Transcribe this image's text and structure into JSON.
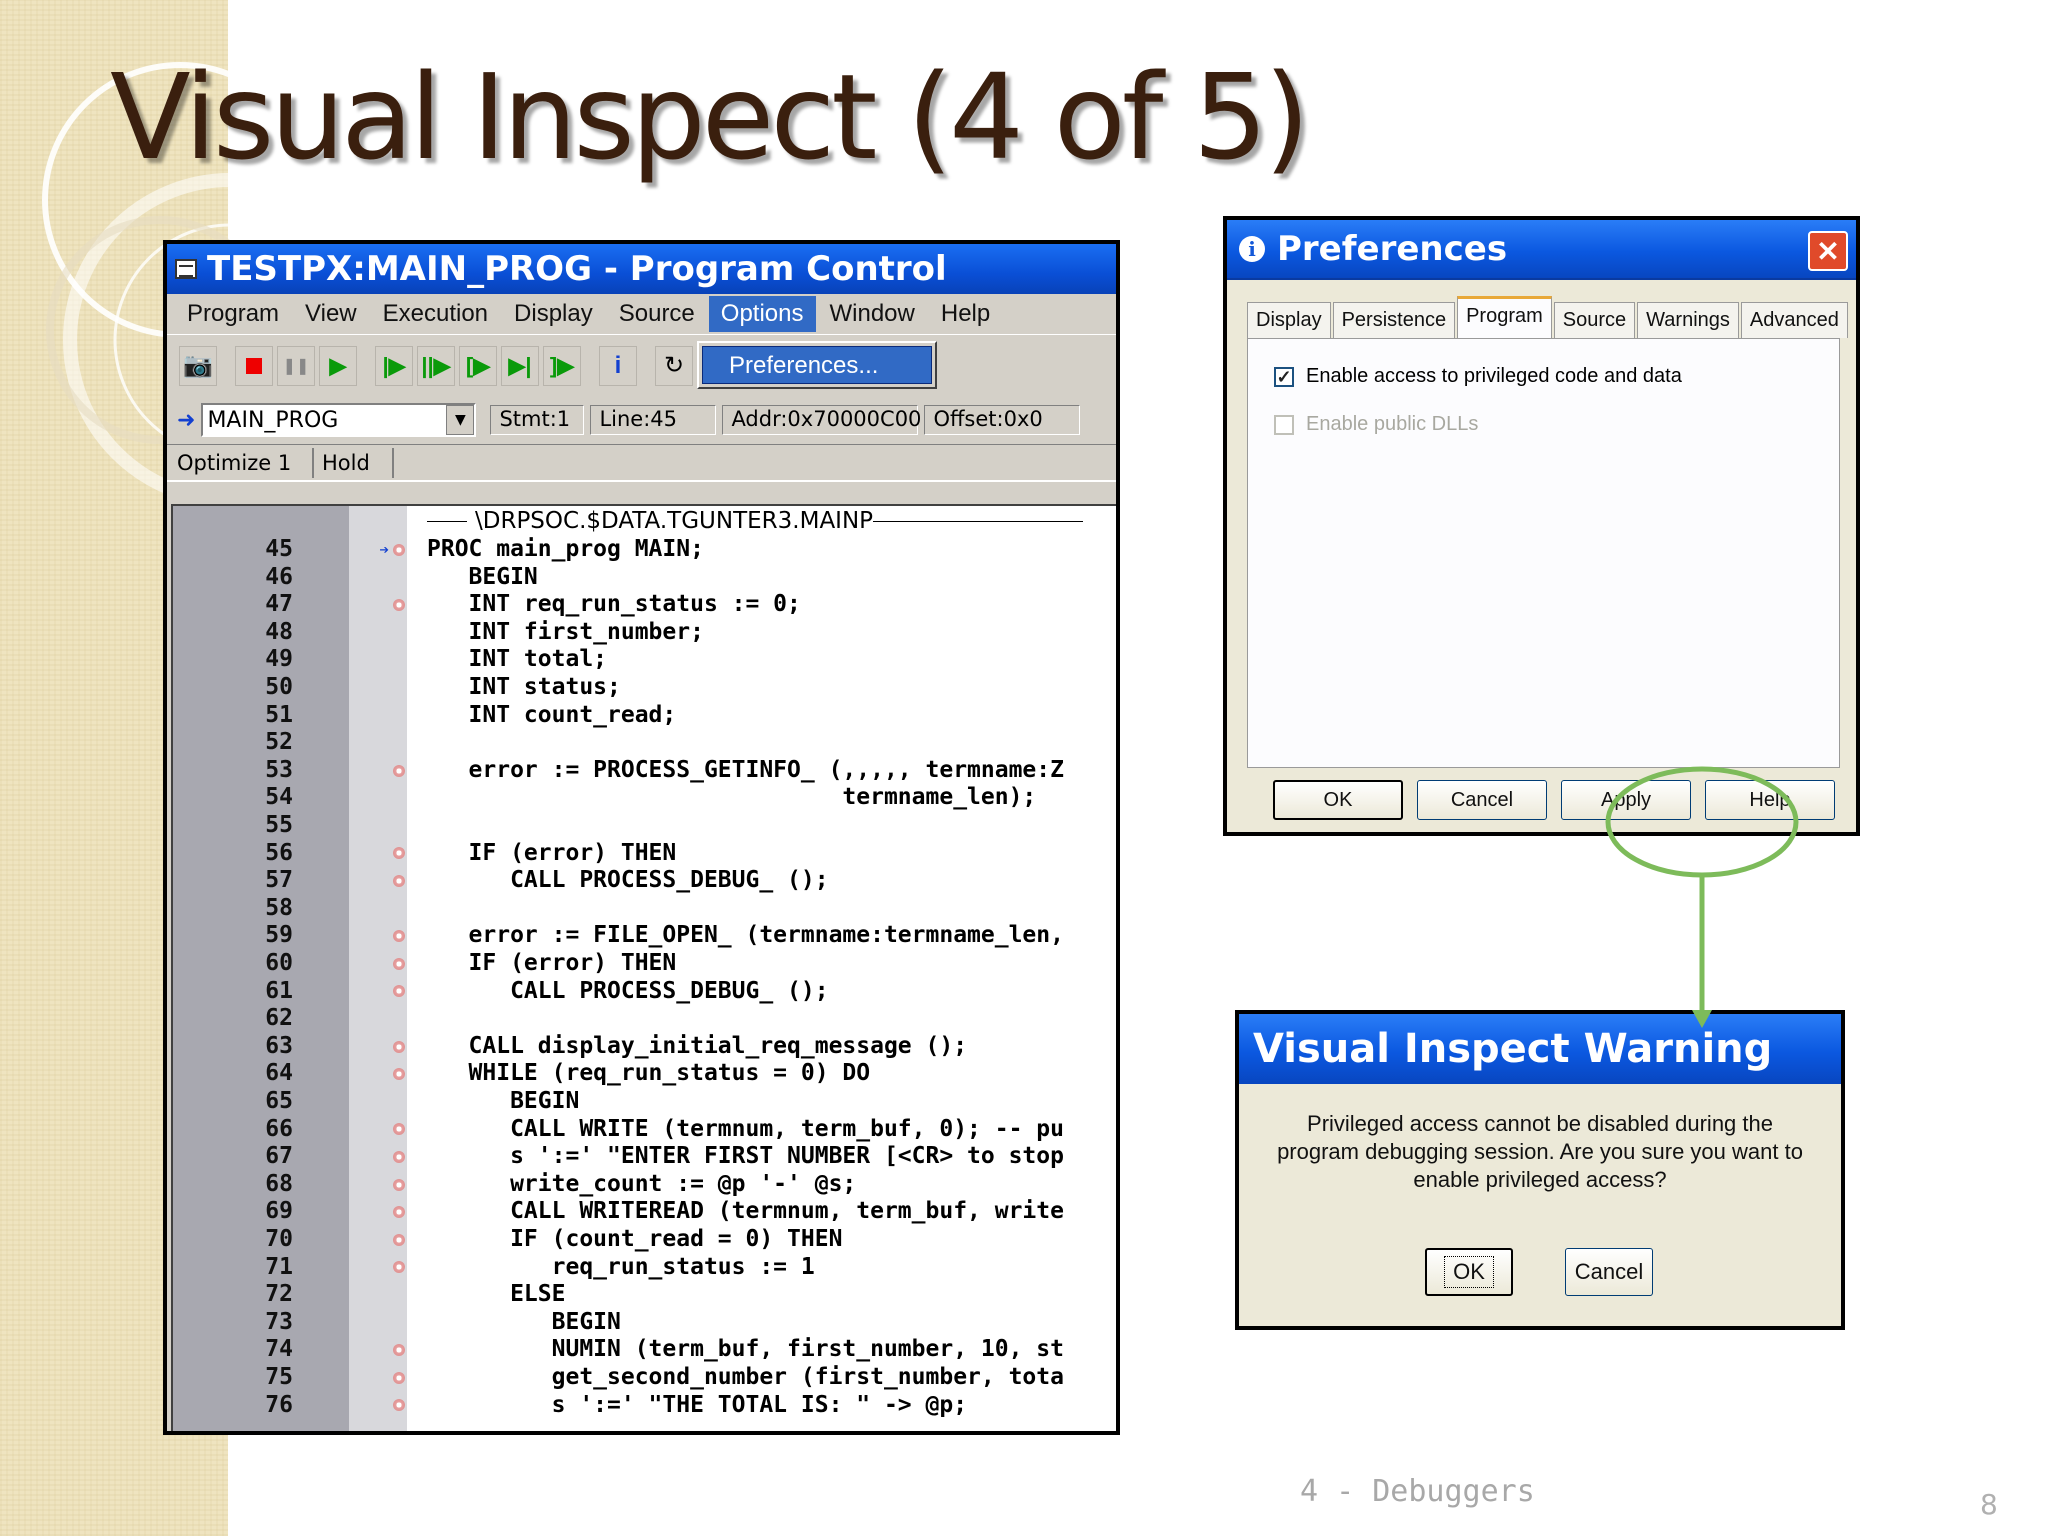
{
  "slide": {
    "title": "Visual Inspect (4 of 5)",
    "footer": "4 - Debuggers",
    "page_number": "8"
  },
  "program_control": {
    "title": "TESTPX:MAIN_PROG - Program Control",
    "menu": [
      "Program",
      "View",
      "Execution",
      "Display",
      "Source",
      "Options",
      "Window",
      "Help"
    ],
    "active_menu": "Options",
    "dropdown_item": "Preferences...",
    "procedure": "MAIN_PROG",
    "location": {
      "stmt": "Stmt:1",
      "line": "Line:45",
      "addr": "Addr:0x70000C00",
      "offset": "Offset:0x0"
    },
    "status": {
      "optimize": "Optimize 1",
      "state": "Hold"
    },
    "file_header": "\\DRPSOC.$DATA.TGUNTER3.MAINP",
    "code_lines": [
      {
        "n": "45",
        "bp": true,
        "cur": true,
        "code": "PROC main_prog MAIN;"
      },
      {
        "n": "46",
        "bp": false,
        "cur": false,
        "code": "   BEGIN"
      },
      {
        "n": "47",
        "bp": true,
        "cur": false,
        "code": "   INT req_run_status := 0;"
      },
      {
        "n": "48",
        "bp": false,
        "cur": false,
        "code": "   INT first_number;"
      },
      {
        "n": "49",
        "bp": false,
        "cur": false,
        "code": "   INT total;"
      },
      {
        "n": "50",
        "bp": false,
        "cur": false,
        "code": "   INT status;"
      },
      {
        "n": "51",
        "bp": false,
        "cur": false,
        "code": "   INT count_read;"
      },
      {
        "n": "52",
        "bp": false,
        "cur": false,
        "code": ""
      },
      {
        "n": "53",
        "bp": true,
        "cur": false,
        "code": "   error := PROCESS_GETINFO_ (,,,,, termname:Z"
      },
      {
        "n": "54",
        "bp": false,
        "cur": false,
        "code": "                              termname_len);"
      },
      {
        "n": "55",
        "bp": false,
        "cur": false,
        "code": ""
      },
      {
        "n": "56",
        "bp": true,
        "cur": false,
        "code": "   IF (error) THEN"
      },
      {
        "n": "57",
        "bp": true,
        "cur": false,
        "code": "      CALL PROCESS_DEBUG_ ();"
      },
      {
        "n": "58",
        "bp": false,
        "cur": false,
        "code": ""
      },
      {
        "n": "59",
        "bp": true,
        "cur": false,
        "code": "   error := FILE_OPEN_ (termname:termname_len,"
      },
      {
        "n": "60",
        "bp": true,
        "cur": false,
        "code": "   IF (error) THEN"
      },
      {
        "n": "61",
        "bp": true,
        "cur": false,
        "code": "      CALL PROCESS_DEBUG_ ();"
      },
      {
        "n": "62",
        "bp": false,
        "cur": false,
        "code": ""
      },
      {
        "n": "63",
        "bp": true,
        "cur": false,
        "code": "   CALL display_initial_req_message ();"
      },
      {
        "n": "64",
        "bp": true,
        "cur": false,
        "code": "   WHILE (req_run_status = 0) DO"
      },
      {
        "n": "65",
        "bp": false,
        "cur": false,
        "code": "      BEGIN"
      },
      {
        "n": "66",
        "bp": true,
        "cur": false,
        "code": "      CALL WRITE (termnum, term_buf, 0); -- pu"
      },
      {
        "n": "67",
        "bp": true,
        "cur": false,
        "code": "      s ':=' \"ENTER FIRST NUMBER [<CR> to stop"
      },
      {
        "n": "68",
        "bp": true,
        "cur": false,
        "code": "      write_count := @p '-' @s;"
      },
      {
        "n": "69",
        "bp": true,
        "cur": false,
        "code": "      CALL WRITEREAD (termnum, term_buf, write"
      },
      {
        "n": "70",
        "bp": true,
        "cur": false,
        "code": "      IF (count_read = 0) THEN"
      },
      {
        "n": "71",
        "bp": true,
        "cur": false,
        "code": "         req_run_status := 1"
      },
      {
        "n": "72",
        "bp": false,
        "cur": false,
        "code": "      ELSE"
      },
      {
        "n": "73",
        "bp": false,
        "cur": false,
        "code": "         BEGIN"
      },
      {
        "n": "74",
        "bp": true,
        "cur": false,
        "code": "         NUMIN (term_buf, first_number, 10, st"
      },
      {
        "n": "75",
        "bp": true,
        "cur": false,
        "code": "         get_second_number (first_number, tota"
      },
      {
        "n": "76",
        "bp": true,
        "cur": false,
        "code": "         s ':=' \"THE TOTAL IS: \" -> @p;"
      }
    ]
  },
  "preferences": {
    "title": "Preferences",
    "tabs": [
      "Display",
      "Persistence",
      "Program",
      "Source",
      "Warnings",
      "Advanced"
    ],
    "selected_tab": "Program",
    "options": [
      {
        "label": "Enable access to privileged code and data",
        "checked": true,
        "enabled": true
      },
      {
        "label": "Enable public DLLs",
        "checked": false,
        "enabled": false
      }
    ],
    "buttons": [
      "OK",
      "Cancel",
      "Apply",
      "Help"
    ]
  },
  "warning": {
    "title": "Visual Inspect Warning",
    "message": "Privileged access cannot be disabled during the program debugging session.  Are you sure you want to enable privileged access?",
    "buttons": [
      "OK",
      "Cancel"
    ]
  },
  "colors": {
    "title_text": "#3a1f0e",
    "xp_title_blue": "#0b58e0",
    "menu_highlight": "#316ac5",
    "annotation_green": "#7dbb5a"
  }
}
